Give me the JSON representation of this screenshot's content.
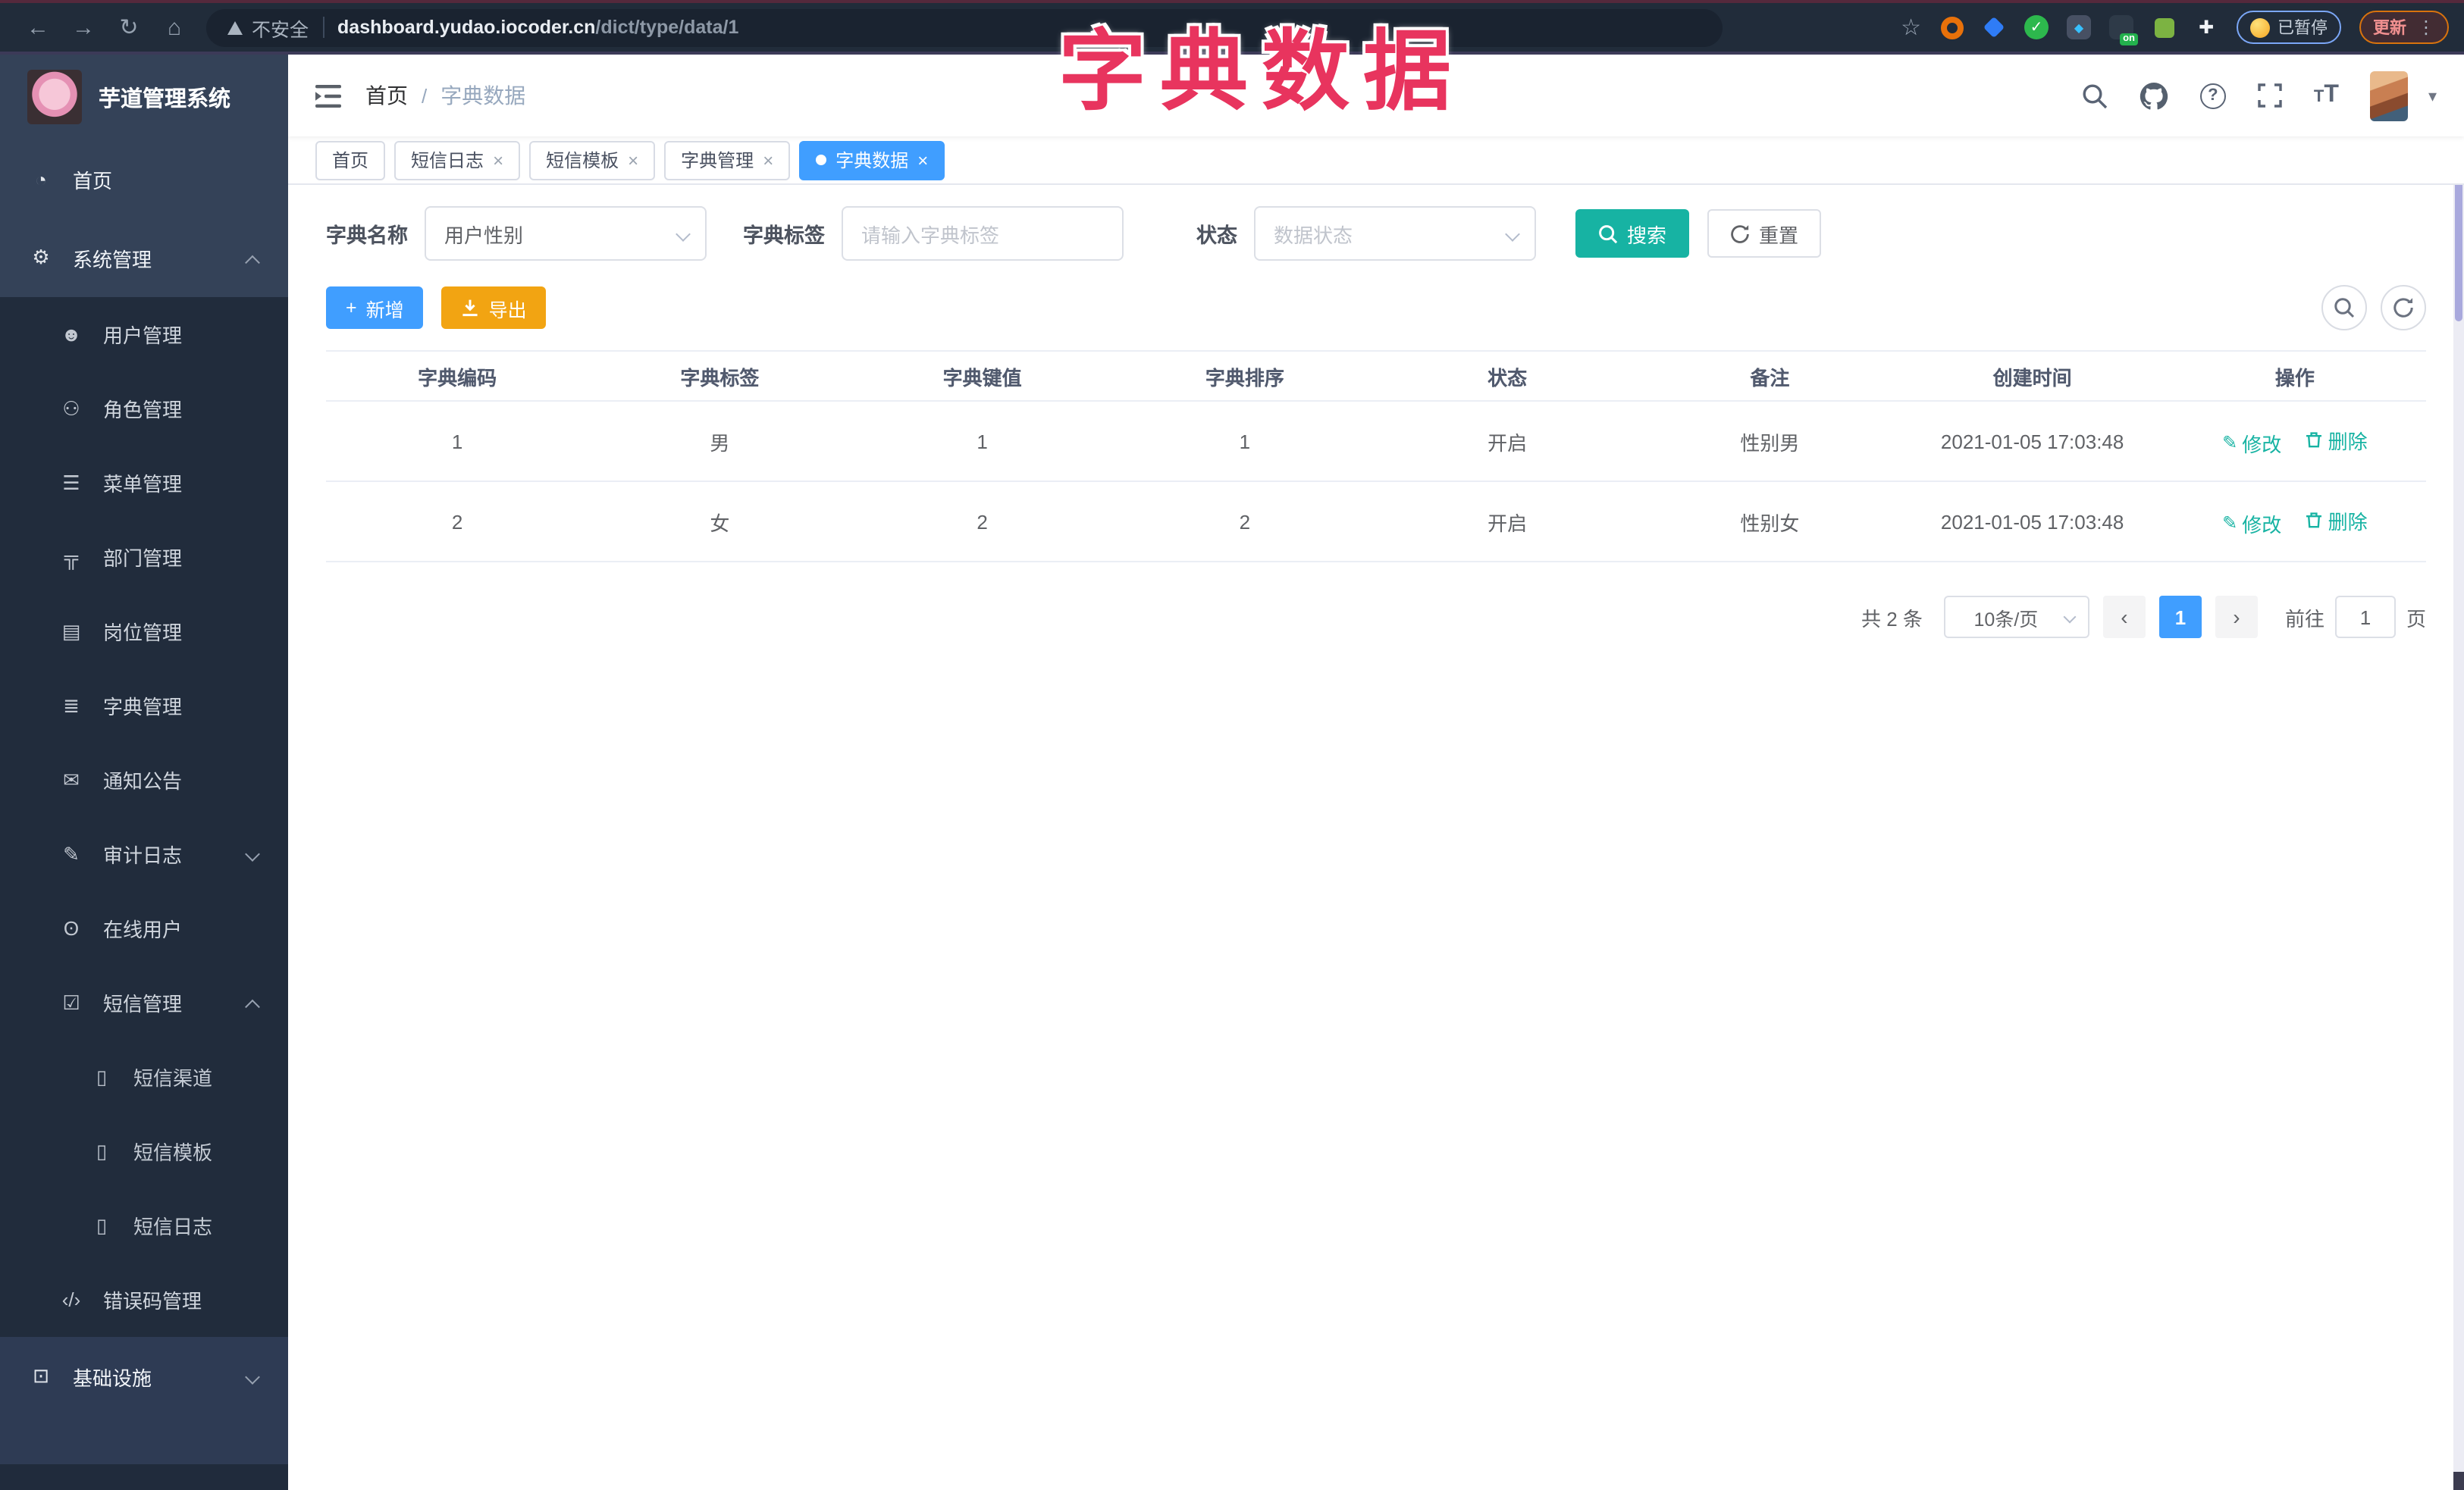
{
  "browser": {
    "security_label": "不安全",
    "url_host": "dashboard.yudao.iocoder.cn",
    "url_path": "/dict/type/data/1",
    "paused_label": "已暂停",
    "update_label": "更新",
    "on_badge": "on",
    "kebab": "⋮"
  },
  "overlay_title": "字典数据",
  "sidebar": {
    "app_title": "芋道管理系统",
    "items": [
      {
        "label": "首页",
        "icon": "dashboard-icon",
        "level": 1
      },
      {
        "label": "系统管理",
        "icon": "gear-icon",
        "level": 1,
        "state": "expanded"
      },
      {
        "label": "用户管理",
        "icon": "user-icon",
        "level": 2
      },
      {
        "label": "角色管理",
        "icon": "role-icon",
        "level": 2
      },
      {
        "label": "菜单管理",
        "icon": "menu-icon",
        "level": 2
      },
      {
        "label": "部门管理",
        "icon": "dept-tree-icon",
        "level": 2
      },
      {
        "label": "岗位管理",
        "icon": "post-icon",
        "level": 2
      },
      {
        "label": "字典管理",
        "icon": "dict-book-icon",
        "level": 2
      },
      {
        "label": "通知公告",
        "icon": "notice-icon",
        "level": 2
      },
      {
        "label": "审计日志",
        "icon": "audit-log-icon",
        "level": 2,
        "state": "collapsed"
      },
      {
        "label": "在线用户",
        "icon": "online-user-icon",
        "level": 2
      },
      {
        "label": "短信管理",
        "icon": "sms-shield-icon",
        "level": 2,
        "state": "expanded"
      },
      {
        "label": "短信渠道",
        "icon": "phone-icon",
        "level": 3
      },
      {
        "label": "短信模板",
        "icon": "phone-icon",
        "level": 3
      },
      {
        "label": "短信日志",
        "icon": "phone-icon",
        "level": 3
      },
      {
        "label": "错误码管理",
        "icon": "code-icon",
        "level": 2
      },
      {
        "label": "基础设施",
        "icon": "infra-icon",
        "level": 1,
        "state": "collapsed"
      }
    ]
  },
  "header": {
    "breadcrumb": [
      "首页",
      "字典数据"
    ],
    "separator": "/"
  },
  "tabs": [
    {
      "label": "首页",
      "closable": false,
      "active": false
    },
    {
      "label": "短信日志",
      "closable": true,
      "active": false
    },
    {
      "label": "短信模板",
      "closable": true,
      "active": false
    },
    {
      "label": "字典管理",
      "closable": true,
      "active": false
    },
    {
      "label": "字典数据",
      "closable": true,
      "active": true
    }
  ],
  "filters": {
    "dict_name_label": "字典名称",
    "dict_name_value": "用户性别",
    "dict_label_label": "字典标签",
    "dict_label_placeholder": "请输入字典标签",
    "status_label": "状态",
    "status_placeholder": "数据状态",
    "search_label": "搜索",
    "reset_label": "重置"
  },
  "toolbar": {
    "add_label": "新增",
    "export_label": "导出"
  },
  "table": {
    "columns": [
      "字典编码",
      "字典标签",
      "字典键值",
      "字典排序",
      "状态",
      "备注",
      "创建时间",
      "操作"
    ],
    "rows": [
      {
        "code": "1",
        "label": "男",
        "value": "1",
        "sort": "1",
        "status": "开启",
        "remark": "性别男",
        "created": "2021-01-05 17:03:48"
      },
      {
        "code": "2",
        "label": "女",
        "value": "2",
        "sort": "2",
        "status": "开启",
        "remark": "性别女",
        "created": "2021-01-05 17:03:48"
      }
    ],
    "edit_label": "修改",
    "delete_label": "删除"
  },
  "pagination": {
    "total_text": "共 2 条",
    "page_size_text": "10条/页",
    "prev": "‹",
    "next": "›",
    "current_page": "1",
    "goto_label": "前往",
    "goto_value": "1",
    "page_unit": "页"
  },
  "colors": {
    "accent_blue": "#409eff",
    "search_teal": "#17b3a3",
    "export_orange": "#f2a412",
    "overlay_pink": "#e8345e",
    "sidebar_bg": "#344258",
    "submenu_bg": "#212c3c"
  }
}
